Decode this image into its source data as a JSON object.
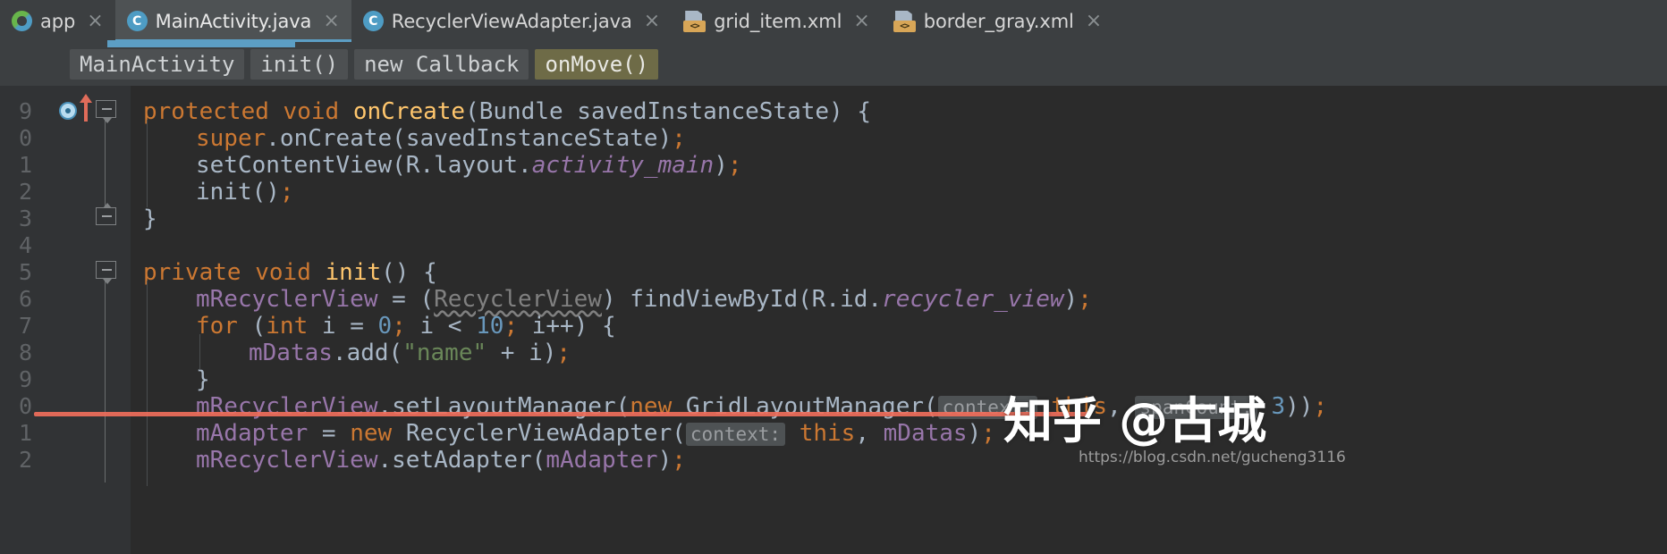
{
  "tabs": [
    {
      "label": "app",
      "icon": "module-icon",
      "active": false,
      "close": "×"
    },
    {
      "label": "MainActivity.java",
      "icon": "java-class-icon",
      "active": true,
      "close": "×"
    },
    {
      "label": "RecyclerViewAdapter.java",
      "icon": "java-class-icon",
      "active": false,
      "close": "×"
    },
    {
      "label": "grid_item.xml",
      "icon": "xml-file-icon",
      "active": false,
      "close": "×"
    },
    {
      "label": "border_gray.xml",
      "icon": "xml-file-icon",
      "active": false,
      "close": "×"
    }
  ],
  "java_icon_letter": "C",
  "xml_icon_letter": "<>",
  "breadcrumb": [
    {
      "label": "MainActivity",
      "selected": false
    },
    {
      "label": "init()",
      "selected": false
    },
    {
      "label": "new Callback",
      "selected": false
    },
    {
      "label": "onMove()",
      "selected": true
    }
  ],
  "gutter": {
    "line_numbers": [
      "9",
      "0",
      "1",
      "2",
      "3",
      "4",
      "5",
      "6",
      "7",
      "8",
      "9",
      "0",
      "1",
      "2"
    ],
    "override_marker_line": 0
  },
  "editor": {
    "lines": [
      {
        "indent": 0,
        "tokens": [
          {
            "t": "protected ",
            "c": "kw"
          },
          {
            "t": "void ",
            "c": "kw"
          },
          {
            "t": "onCreate",
            "c": "meth"
          },
          {
            "t": "(Bundle savedInstanceState) {",
            "c": "txt"
          }
        ]
      },
      {
        "indent": 1,
        "tokens": [
          {
            "t": "super",
            "c": "kw"
          },
          {
            "t": ".onCreate(savedInstanceState)",
            "c": "txt"
          },
          {
            "t": ";",
            "c": "kw"
          }
        ]
      },
      {
        "indent": 1,
        "tokens": [
          {
            "t": "setContentView(R.layout.",
            "c": "txt"
          },
          {
            "t": "activity_main",
            "c": "fld ital"
          },
          {
            "t": ")",
            "c": "txt"
          },
          {
            "t": ";",
            "c": "kw"
          }
        ]
      },
      {
        "indent": 1,
        "tokens": [
          {
            "t": "init()",
            "c": "txt"
          },
          {
            "t": ";",
            "c": "kw"
          }
        ]
      },
      {
        "indent": 0,
        "tokens": [
          {
            "t": "}",
            "c": "txt"
          }
        ]
      },
      {
        "indent": 0,
        "tokens": []
      },
      {
        "indent": 0,
        "tokens": [
          {
            "t": "private ",
            "c": "kw"
          },
          {
            "t": "void ",
            "c": "kw"
          },
          {
            "t": "init",
            "c": "meth"
          },
          {
            "t": "() {",
            "c": "txt"
          }
        ]
      },
      {
        "indent": 1,
        "tokens": [
          {
            "t": "mRecyclerView",
            "c": "fld"
          },
          {
            "t": " = (",
            "c": "txt"
          },
          {
            "t": "RecyclerView",
            "c": "dim warn"
          },
          {
            "t": ") findViewById(R.id.",
            "c": "txt"
          },
          {
            "t": "recycler_view",
            "c": "fld ital"
          },
          {
            "t": ")",
            "c": "txt"
          },
          {
            "t": ";",
            "c": "kw"
          }
        ]
      },
      {
        "indent": 1,
        "tokens": [
          {
            "t": "for ",
            "c": "kw"
          },
          {
            "t": "(",
            "c": "txt"
          },
          {
            "t": "int ",
            "c": "kw"
          },
          {
            "t": "i = ",
            "c": "txt"
          },
          {
            "t": "0",
            "c": "num"
          },
          {
            "t": ";",
            "c": "kw"
          },
          {
            "t": " i < ",
            "c": "txt"
          },
          {
            "t": "10",
            "c": "num"
          },
          {
            "t": ";",
            "c": "kw"
          },
          {
            "t": " i++) {",
            "c": "txt"
          }
        ]
      },
      {
        "indent": 2,
        "tokens": [
          {
            "t": "mDatas",
            "c": "fld"
          },
          {
            "t": ".add(",
            "c": "txt"
          },
          {
            "t": "\"name\"",
            "c": "str"
          },
          {
            "t": " + i)",
            "c": "txt"
          },
          {
            "t": ";",
            "c": "kw"
          }
        ]
      },
      {
        "indent": 1,
        "tokens": [
          {
            "t": "}",
            "c": "txt"
          }
        ]
      },
      {
        "indent": 1,
        "tokens": [
          {
            "t": "mRecyclerView",
            "c": "fld"
          },
          {
            "t": ".setLayoutManager(",
            "c": "txt"
          },
          {
            "t": "new ",
            "c": "kw"
          },
          {
            "t": "GridLayoutManager(",
            "c": "txt"
          },
          {
            "t": "context:",
            "c": "hint"
          },
          {
            "t": " this",
            "c": "kw"
          },
          {
            "t": ", ",
            "c": "txt"
          },
          {
            "t": "spanCount:",
            "c": "hint"
          },
          {
            "t": " 3",
            "c": "num"
          },
          {
            "t": "))",
            "c": "txt"
          },
          {
            "t": ";",
            "c": "kw"
          }
        ]
      },
      {
        "indent": 1,
        "tokens": [
          {
            "t": "mAdapter",
            "c": "fld"
          },
          {
            "t": " = ",
            "c": "txt"
          },
          {
            "t": "new ",
            "c": "kw"
          },
          {
            "t": "RecyclerViewAdapter(",
            "c": "txt"
          },
          {
            "t": "context:",
            "c": "hint"
          },
          {
            "t": " this",
            "c": "kw"
          },
          {
            "t": ", ",
            "c": "txt"
          },
          {
            "t": "mDatas",
            "c": "fld"
          },
          {
            "t": ")",
            "c": "txt"
          },
          {
            "t": ";",
            "c": "kw"
          }
        ]
      },
      {
        "indent": 1,
        "tokens": [
          {
            "t": "mRecyclerView",
            "c": "fld"
          },
          {
            "t": ".setAdapter(",
            "c": "txt"
          },
          {
            "t": "mAdapter",
            "c": "fld"
          },
          {
            "t": ")",
            "c": "txt"
          },
          {
            "t": ";",
            "c": "kw"
          }
        ]
      }
    ]
  },
  "annotation": {
    "color": "#ef6e5b"
  },
  "watermark": {
    "text": "知乎 @古城",
    "url": "https://blog.csdn.net/gucheng3116"
  },
  "colors": {
    "editor_bg": "#2b2b2b",
    "chrome_bg": "#3c3f41",
    "active_tab_bg": "#4e5254",
    "tab_underline": "#5c9ec4",
    "keyword": "#cc7832",
    "method": "#ffc66d",
    "field": "#9876aa",
    "number": "#6897bb",
    "string": "#6a8759",
    "text": "#a9b7c6",
    "crumb_selected_bg": "#6e6b47",
    "annotation": "#ef6e5b"
  }
}
